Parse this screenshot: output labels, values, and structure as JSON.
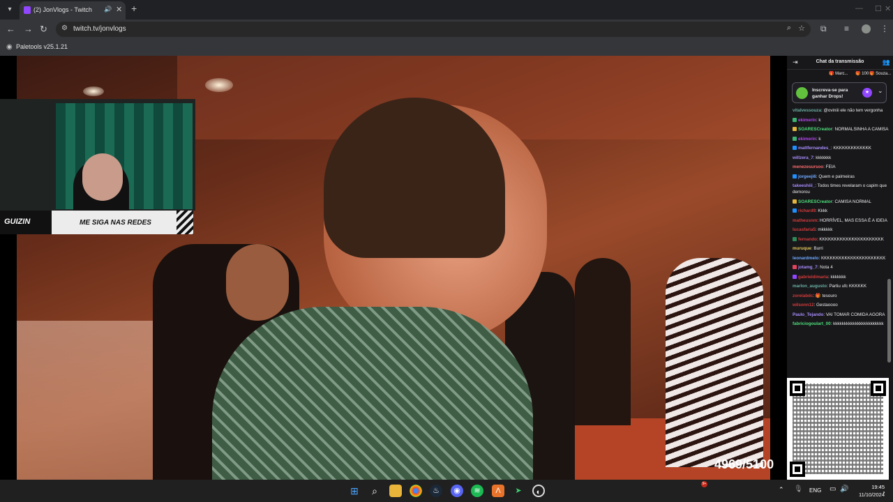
{
  "browser": {
    "tab_title": "(2) JonVlogs - Twitch",
    "url": "twitch.tv/jonvlogs",
    "bookmark": "Paletools v25.1.21"
  },
  "stream": {
    "counter": "4969/5100",
    "banner_logo": "GUIZIN",
    "banner_text": "ME SIGA NAS REDES"
  },
  "chat": {
    "title": "Chat da transmissão",
    "leaderboard": [
      {
        "name": "Marc...",
        "value": ""
      },
      {
        "name": "",
        "value": "100"
      },
      {
        "name": "Souza...",
        "value": ""
      }
    ],
    "drops_text": "Inscreva-se para ganhar Drops!",
    "messages": [
      {
        "user": "vitalvessouza",
        "color": "#6ab0a3",
        "text": ": @oviniii ele não tem vergonha",
        "badge": ""
      },
      {
        "user": "ekimerin",
        "color": "#b545f0",
        "text": ": k",
        "badge": "#3cb371"
      },
      {
        "user": "SOARESCreator",
        "color": "#4edf7a",
        "text": ": NORMALSINHA A CAMISA",
        "badge": "#e5b53c"
      },
      {
        "user": "ekimerin",
        "color": "#b545f0",
        "text": ": k",
        "badge": "#3cb371"
      },
      {
        "user": "mattfernandes_",
        "color": "#a78bfa",
        "text": ": KKKKKKKKKKKKK",
        "badge": "#1e90ff"
      },
      {
        "user": "willzera_7",
        "color": "#a78bfa",
        "text": ": kkkkkkk",
        "badge": ""
      },
      {
        "user": "menezesursoo",
        "color": "#ff6b6b",
        "text": ": FEIA",
        "badge": ""
      },
      {
        "user": "jorgeeji6",
        "color": "#6fa8ff",
        "text": ": Quem e palmeiras",
        "badge": "#1e90ff"
      },
      {
        "user": "takeeshiii_",
        "color": "#a78bfa",
        "text": ": Todos times revelaram o capim que demorou",
        "badge": ""
      },
      {
        "user": "SOARESCreator",
        "color": "#4edf7a",
        "text": ": CAMISA NORMAL",
        "badge": "#e5b53c"
      },
      {
        "user": "richard9",
        "color": "#d43a3a",
        "text": ": Kkkk",
        "badge": "#1e90ff"
      },
      {
        "user": "matheusnm",
        "color": "#d43a3a",
        "text": ": HORRÍVEL, MAS ESSA É A IDEIA",
        "badge": ""
      },
      {
        "user": "lucasfaria5",
        "color": "#d43a3a",
        "text": ": mkkkkk",
        "badge": ""
      },
      {
        "user": "fernando",
        "color": "#d43a3a",
        "text": ": KKKKKKKKKKKKKKKKKKKKKK",
        "badge": "#2e8b57"
      },
      {
        "user": "muruque",
        "color": "#e5c85a",
        "text": ": Burri",
        "badge": ""
      },
      {
        "user": "leonardmelo",
        "color": "#6fa8ff",
        "text": ": KKKKKKKKKKKKKKKKKKKKKK",
        "badge": ""
      },
      {
        "user": "jotamg_7",
        "color": "#a78bfa",
        "text": ": Nota 4",
        "badge": "#e2445c"
      },
      {
        "user": "gabrieldimaria",
        "color": "#d43a3a",
        "text": ": kkkkkkk",
        "badge": "#9147ff"
      },
      {
        "user": "marlon_augusto",
        "color": "#6ab0a3",
        "text": ": Partiu ufc KKKKKK",
        "badge": ""
      },
      {
        "user": "zoreiabdc",
        "color": "#d43a3a",
        "text": ": 🎁 tesouro",
        "badge": ""
      },
      {
        "user": "wilsonn12",
        "color": "#d43a3a",
        "text": ": Gestaoooo",
        "badge": ""
      },
      {
        "user": "Paulo_Tejando",
        "color": "#a78bfa",
        "text": ": VAI TOMAR COMIDA AGORA",
        "badge": ""
      },
      {
        "user": "fabriciogoulart_00",
        "color": "#4edf7a",
        "text": ": kkkkkkkkkkkkkkkkkkkkkkk",
        "badge": ""
      }
    ]
  },
  "taskbar": {
    "lang": "ENG",
    "time": "19:45",
    "date": "11/10/2024",
    "discord_badge": "9+"
  },
  "colors": {
    "twitch_purple": "#9147ff",
    "chat_bg": "#18181b",
    "browser_bg": "#35363a"
  }
}
